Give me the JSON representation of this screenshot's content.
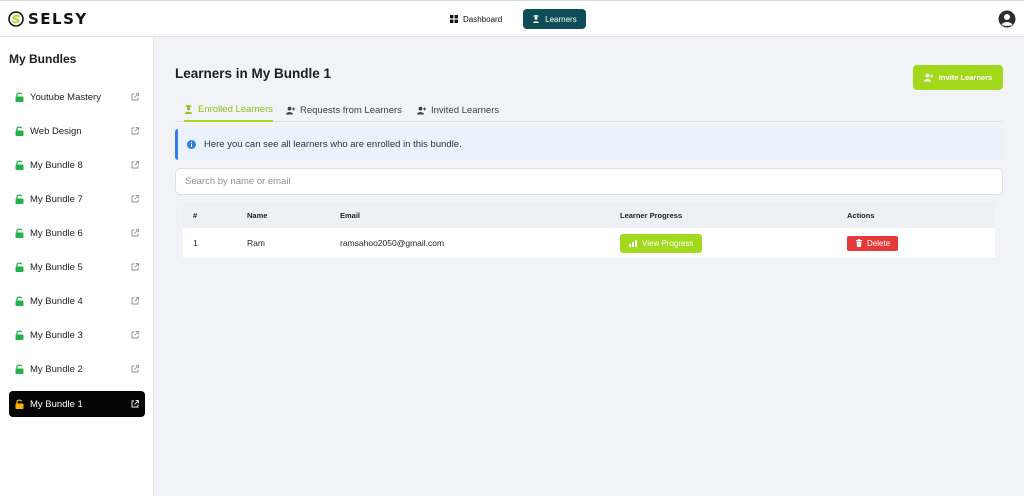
{
  "app": {
    "logo_text": "SELSY"
  },
  "nav": {
    "items": [
      {
        "label": "Dashboard",
        "icon": "grid-icon"
      },
      {
        "label": "Learners",
        "icon": "learner-icon"
      }
    ],
    "active": "Learners"
  },
  "sidebar": {
    "title": "My Bundles",
    "items": [
      {
        "label": "Youtube Mastery"
      },
      {
        "label": "Web Design"
      },
      {
        "label": "My Bundle 8"
      },
      {
        "label": "My Bundle 7"
      },
      {
        "label": "My Bundle 6"
      },
      {
        "label": "My Bundle 5"
      },
      {
        "label": "My Bundle 4"
      },
      {
        "label": "My Bundle 3"
      },
      {
        "label": "My Bundle 2"
      },
      {
        "label": "My Bundle 1"
      }
    ],
    "active": "My Bundle 1"
  },
  "main": {
    "title": "Learners in My Bundle 1",
    "invite_label": "Invite Learners",
    "tabs": [
      {
        "label": "Enrolled Learners"
      },
      {
        "label": "Requests from Learners"
      },
      {
        "label": "Invited Learners"
      }
    ],
    "info_text": "Here you can see all learners who are enrolled in this bundle.",
    "search": {
      "placeholder": "Search by name or email",
      "value": ""
    },
    "table": {
      "headers": [
        "#",
        "Name",
        "Email",
        "Learner Progress",
        "Actions"
      ],
      "rows": [
        {
          "num": "1",
          "name": "Ram",
          "email": "ramsahoo2050@gmail.com",
          "progress_label": "View Progress",
          "delete_label": "Delete"
        }
      ]
    }
  },
  "colors": {
    "accent_green": "#a2d91d",
    "active_nav": "#0d4d57",
    "lock_green": "#22b14c",
    "lock_active": "#f4b400",
    "info_blue": "#2f7fe0",
    "delete_red": "#e63a3a"
  }
}
